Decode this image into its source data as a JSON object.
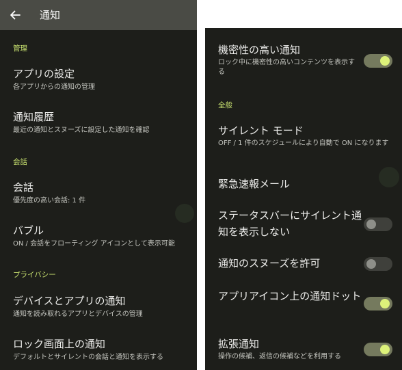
{
  "left": {
    "appbar": {
      "title": "通知"
    },
    "sections": {
      "manage": "管理",
      "conversation": "会話",
      "privacy": "プライバシー"
    },
    "items": {
      "app_settings": {
        "title": "アプリの設定",
        "summary": "各アプリからの通知の管理"
      },
      "history": {
        "title": "通知履歴",
        "summary": "最近の通知とスヌーズに設定した通知を確認"
      },
      "conversations": {
        "title": "会話",
        "summary": "優先度の高い会話: 1 件"
      },
      "bubbles": {
        "title": "バブル",
        "summary": "ON / 会話をフローティング アイコンとして表示可能"
      },
      "device_app": {
        "title": "デバイスとアプリの通知",
        "summary": "通知を読み取れるアプリとデバイスの管理"
      },
      "lockscreen": {
        "title": "ロック画面上の通知",
        "summary": "デフォルトとサイレントの会話と通知を表示する"
      }
    }
  },
  "right": {
    "sections": {
      "general": "全般"
    },
    "items": {
      "sensitive": {
        "title": "機密性の高い通知",
        "summary": "ロック中に機密性の高いコンテンツを表示する",
        "enabled": true
      },
      "silent_mode": {
        "title": "サイレント モード",
        "summary": "OFF / 1 件のスケジュールにより自動で ON になります"
      },
      "emergency": {
        "title": "緊急速報メール"
      },
      "hide_silent": {
        "title": "ステータスバーにサイレント通知を表示しない",
        "enabled": false
      },
      "snooze": {
        "title": "通知のスヌーズを許可",
        "enabled": false
      },
      "dot": {
        "title": "アプリアイコン上の通知ドット",
        "enabled": true
      },
      "enhanced": {
        "title": "拡張通知",
        "summary": "操作の候補、返信の候補などを利用する",
        "enabled": true
      }
    }
  },
  "colors": {
    "background": "#1d1e1a",
    "appbar": "#4a4b45",
    "accent": "#c7e06f",
    "toggle_on_track": "#757a5e",
    "toggle_on_thumb": "#ddf27a",
    "toggle_off_track": "#3f403b"
  },
  "icons": {
    "back": "arrow-left-icon"
  }
}
